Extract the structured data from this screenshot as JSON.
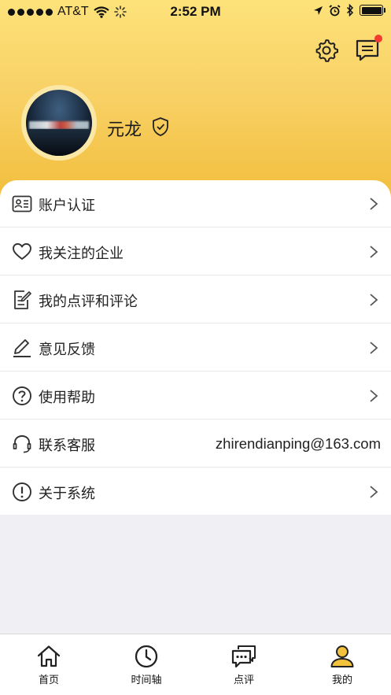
{
  "status_bar": {
    "carrier": "AT&T",
    "time": "2:52 PM",
    "icons": [
      "signal-dots",
      "wifi-icon",
      "activity-spinner-icon",
      "location-arrow-icon",
      "alarm-icon",
      "bluetooth-icon",
      "battery-icon"
    ]
  },
  "header": {
    "username": "元龙",
    "icons": [
      "settings-gear-icon",
      "messages-icon",
      "verified-shield-icon"
    ],
    "message_badge_color": "#f33b2f",
    "gradient_colors": [
      "#fde27a",
      "#f2bd3a"
    ]
  },
  "menu": {
    "items": [
      {
        "label": "账户认证",
        "icon": "id-card-icon",
        "has_chevron": true
      },
      {
        "label": "我关注的企业",
        "icon": "heart-icon",
        "has_chevron": true
      },
      {
        "label": "我的点评和评论",
        "icon": "edit-note-icon",
        "has_chevron": true
      },
      {
        "label": "意见反馈",
        "icon": "pen-icon",
        "has_chevron": true
      },
      {
        "label": "使用帮助",
        "icon": "question-circle-icon",
        "has_chevron": true
      },
      {
        "label": "联系客服",
        "icon": "headset-icon",
        "value": "zhirendianping@163.com",
        "has_chevron": false
      },
      {
        "label": "关于系统",
        "icon": "exclamation-circle-icon",
        "has_chevron": true
      }
    ]
  },
  "tabbar": {
    "tabs": [
      {
        "label": "首页",
        "icon": "home-icon"
      },
      {
        "label": "时间轴",
        "icon": "clock-icon"
      },
      {
        "label": "点评",
        "icon": "chat-bubbles-icon"
      },
      {
        "label": "我的",
        "icon": "user-icon",
        "active": true
      }
    ],
    "active_color": "#f3c23c"
  }
}
